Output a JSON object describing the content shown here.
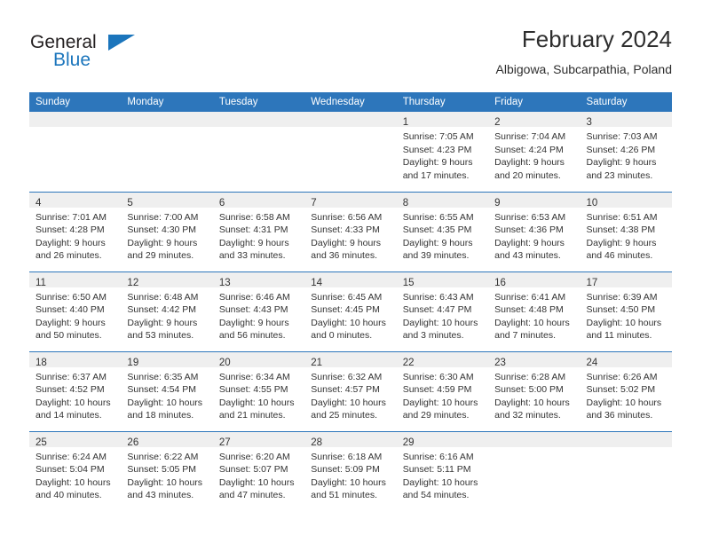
{
  "brand": {
    "name_part1": "General",
    "name_part2": "Blue",
    "accent_color": "#1b75bc"
  },
  "header": {
    "title": "February 2024",
    "subtitle": "Albigowa, Subcarpathia, Poland"
  },
  "theme": {
    "header_bar_color": "#2d76bb",
    "daynum_band_color": "#efefef",
    "text_color": "#333333"
  },
  "calendar": {
    "weekday_headers": [
      "Sunday",
      "Monday",
      "Tuesday",
      "Wednesday",
      "Thursday",
      "Friday",
      "Saturday"
    ],
    "weeks": [
      [
        {
          "day": "",
          "lines": []
        },
        {
          "day": "",
          "lines": []
        },
        {
          "day": "",
          "lines": []
        },
        {
          "day": "",
          "lines": []
        },
        {
          "day": "1",
          "lines": [
            "Sunrise: 7:05 AM",
            "Sunset: 4:23 PM",
            "Daylight: 9 hours",
            "and 17 minutes."
          ]
        },
        {
          "day": "2",
          "lines": [
            "Sunrise: 7:04 AM",
            "Sunset: 4:24 PM",
            "Daylight: 9 hours",
            "and 20 minutes."
          ]
        },
        {
          "day": "3",
          "lines": [
            "Sunrise: 7:03 AM",
            "Sunset: 4:26 PM",
            "Daylight: 9 hours",
            "and 23 minutes."
          ]
        }
      ],
      [
        {
          "day": "4",
          "lines": [
            "Sunrise: 7:01 AM",
            "Sunset: 4:28 PM",
            "Daylight: 9 hours",
            "and 26 minutes."
          ]
        },
        {
          "day": "5",
          "lines": [
            "Sunrise: 7:00 AM",
            "Sunset: 4:30 PM",
            "Daylight: 9 hours",
            "and 29 minutes."
          ]
        },
        {
          "day": "6",
          "lines": [
            "Sunrise: 6:58 AM",
            "Sunset: 4:31 PM",
            "Daylight: 9 hours",
            "and 33 minutes."
          ]
        },
        {
          "day": "7",
          "lines": [
            "Sunrise: 6:56 AM",
            "Sunset: 4:33 PM",
            "Daylight: 9 hours",
            "and 36 minutes."
          ]
        },
        {
          "day": "8",
          "lines": [
            "Sunrise: 6:55 AM",
            "Sunset: 4:35 PM",
            "Daylight: 9 hours",
            "and 39 minutes."
          ]
        },
        {
          "day": "9",
          "lines": [
            "Sunrise: 6:53 AM",
            "Sunset: 4:36 PM",
            "Daylight: 9 hours",
            "and 43 minutes."
          ]
        },
        {
          "day": "10",
          "lines": [
            "Sunrise: 6:51 AM",
            "Sunset: 4:38 PM",
            "Daylight: 9 hours",
            "and 46 minutes."
          ]
        }
      ],
      [
        {
          "day": "11",
          "lines": [
            "Sunrise: 6:50 AM",
            "Sunset: 4:40 PM",
            "Daylight: 9 hours",
            "and 50 minutes."
          ]
        },
        {
          "day": "12",
          "lines": [
            "Sunrise: 6:48 AM",
            "Sunset: 4:42 PM",
            "Daylight: 9 hours",
            "and 53 minutes."
          ]
        },
        {
          "day": "13",
          "lines": [
            "Sunrise: 6:46 AM",
            "Sunset: 4:43 PM",
            "Daylight: 9 hours",
            "and 56 minutes."
          ]
        },
        {
          "day": "14",
          "lines": [
            "Sunrise: 6:45 AM",
            "Sunset: 4:45 PM",
            "Daylight: 10 hours",
            "and 0 minutes."
          ]
        },
        {
          "day": "15",
          "lines": [
            "Sunrise: 6:43 AM",
            "Sunset: 4:47 PM",
            "Daylight: 10 hours",
            "and 3 minutes."
          ]
        },
        {
          "day": "16",
          "lines": [
            "Sunrise: 6:41 AM",
            "Sunset: 4:48 PM",
            "Daylight: 10 hours",
            "and 7 minutes."
          ]
        },
        {
          "day": "17",
          "lines": [
            "Sunrise: 6:39 AM",
            "Sunset: 4:50 PM",
            "Daylight: 10 hours",
            "and 11 minutes."
          ]
        }
      ],
      [
        {
          "day": "18",
          "lines": [
            "Sunrise: 6:37 AM",
            "Sunset: 4:52 PM",
            "Daylight: 10 hours",
            "and 14 minutes."
          ]
        },
        {
          "day": "19",
          "lines": [
            "Sunrise: 6:35 AM",
            "Sunset: 4:54 PM",
            "Daylight: 10 hours",
            "and 18 minutes."
          ]
        },
        {
          "day": "20",
          "lines": [
            "Sunrise: 6:34 AM",
            "Sunset: 4:55 PM",
            "Daylight: 10 hours",
            "and 21 minutes."
          ]
        },
        {
          "day": "21",
          "lines": [
            "Sunrise: 6:32 AM",
            "Sunset: 4:57 PM",
            "Daylight: 10 hours",
            "and 25 minutes."
          ]
        },
        {
          "day": "22",
          "lines": [
            "Sunrise: 6:30 AM",
            "Sunset: 4:59 PM",
            "Daylight: 10 hours",
            "and 29 minutes."
          ]
        },
        {
          "day": "23",
          "lines": [
            "Sunrise: 6:28 AM",
            "Sunset: 5:00 PM",
            "Daylight: 10 hours",
            "and 32 minutes."
          ]
        },
        {
          "day": "24",
          "lines": [
            "Sunrise: 6:26 AM",
            "Sunset: 5:02 PM",
            "Daylight: 10 hours",
            "and 36 minutes."
          ]
        }
      ],
      [
        {
          "day": "25",
          "lines": [
            "Sunrise: 6:24 AM",
            "Sunset: 5:04 PM",
            "Daylight: 10 hours",
            "and 40 minutes."
          ]
        },
        {
          "day": "26",
          "lines": [
            "Sunrise: 6:22 AM",
            "Sunset: 5:05 PM",
            "Daylight: 10 hours",
            "and 43 minutes."
          ]
        },
        {
          "day": "27",
          "lines": [
            "Sunrise: 6:20 AM",
            "Sunset: 5:07 PM",
            "Daylight: 10 hours",
            "and 47 minutes."
          ]
        },
        {
          "day": "28",
          "lines": [
            "Sunrise: 6:18 AM",
            "Sunset: 5:09 PM",
            "Daylight: 10 hours",
            "and 51 minutes."
          ]
        },
        {
          "day": "29",
          "lines": [
            "Sunrise: 6:16 AM",
            "Sunset: 5:11 PM",
            "Daylight: 10 hours",
            "and 54 minutes."
          ]
        },
        {
          "day": "",
          "lines": []
        },
        {
          "day": "",
          "lines": []
        }
      ]
    ]
  }
}
